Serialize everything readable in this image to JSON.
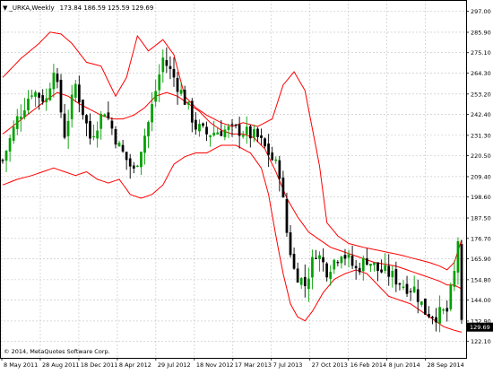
{
  "window": {
    "symbol": "_URKA,Weekly",
    "ohlc": "173.84 186.59 125.59 129.69",
    "copyright": "© 2014, MetaQuotes Software Corp."
  },
  "colors": {
    "background": "#ffffff",
    "grid": "#c0c0c0",
    "band": "#ff0000",
    "bull": "#00a000",
    "bear": "#000000",
    "last_price_label_bg": "#000000",
    "last_price_label_fg": "#ffffff"
  },
  "chart_data": {
    "type": "candlestick",
    "title": "_URKA,Weekly",
    "ylim": [
      121.0,
      303.0
    ],
    "grid": true,
    "y_ticks": [
      "297.00",
      "285.90",
      "275.10",
      "264.30",
      "253.20",
      "242.40",
      "231.30",
      "220.50",
      "209.40",
      "198.60",
      "187.50",
      "176.70",
      "165.90",
      "154.80",
      "144.00",
      "132.90",
      "122.10"
    ],
    "x_ticks": [
      "8 May 2011",
      "28 Aug 2011",
      "18 Dec 2011",
      "8 Apr 2012",
      "29 Jul 2012",
      "18 Nov 2012",
      "17 Mar 2013",
      "7 Jul 2013",
      "27 Oct 2013",
      "16 Feb 2014",
      "8 Jun 2014",
      "28 Sep 2014"
    ],
    "last_price": "129.69",
    "series": [
      {
        "name": "Price",
        "kind": "candles",
        "close_anchors": [
          [
            0,
            218
          ],
          [
            4,
            240
          ],
          [
            8,
            255
          ],
          [
            12,
            250
          ],
          [
            14,
            268
          ],
          [
            17,
            232
          ],
          [
            20,
            258
          ],
          [
            24,
            230
          ],
          [
            28,
            245
          ],
          [
            32,
            225
          ],
          [
            36,
            212
          ],
          [
            40,
            238
          ],
          [
            44,
            272
          ],
          [
            47,
            262
          ],
          [
            50,
            250
          ],
          [
            53,
            236
          ],
          [
            56,
            232
          ],
          [
            60,
            234
          ],
          [
            65,
            234
          ],
          [
            70,
            230
          ],
          [
            73,
            222
          ],
          [
            76,
            212
          ],
          [
            78,
            180
          ],
          [
            80,
            160
          ],
          [
            83,
            152
          ],
          [
            86,
            170
          ],
          [
            89,
            160
          ],
          [
            93,
            170
          ],
          [
            97,
            160
          ],
          [
            100,
            166
          ],
          [
            103,
            160
          ],
          [
            106,
            158
          ],
          [
            110,
            152
          ],
          [
            113,
            150
          ],
          [
            116,
            138
          ],
          [
            119,
            136
          ],
          [
            122,
            138
          ],
          [
            124,
            158
          ],
          [
            125,
            176
          ],
          [
            126,
            130
          ]
        ]
      },
      {
        "name": "Upper Band",
        "kind": "line",
        "points": [
          [
            0,
            262
          ],
          [
            5,
            272
          ],
          [
            10,
            280
          ],
          [
            13,
            286
          ],
          [
            16,
            285
          ],
          [
            19,
            280
          ],
          [
            23,
            270
          ],
          [
            27,
            268
          ],
          [
            31,
            252
          ],
          [
            34,
            262
          ],
          [
            37,
            284
          ],
          [
            40,
            276
          ],
          [
            44,
            282
          ],
          [
            47,
            274
          ],
          [
            50,
            252
          ],
          [
            53,
            246
          ],
          [
            56,
            242
          ],
          [
            60,
            238
          ],
          [
            63,
            236
          ],
          [
            66,
            238
          ],
          [
            70,
            236
          ],
          [
            74,
            240
          ],
          [
            77,
            258
          ],
          [
            80,
            265
          ],
          [
            83,
            255
          ],
          [
            87,
            215
          ],
          [
            89,
            185
          ],
          [
            92,
            178
          ],
          [
            95,
            174
          ],
          [
            99,
            172
          ],
          [
            104,
            170
          ],
          [
            109,
            168
          ],
          [
            113,
            166
          ],
          [
            117,
            164
          ],
          [
            120,
            162
          ],
          [
            122,
            160
          ],
          [
            124,
            164
          ],
          [
            126,
            176
          ]
        ]
      },
      {
        "name": "Middle Band",
        "kind": "line",
        "points": [
          [
            0,
            232
          ],
          [
            4,
            238
          ],
          [
            8,
            244
          ],
          [
            12,
            250
          ],
          [
            15,
            254
          ],
          [
            18,
            252
          ],
          [
            21,
            248
          ],
          [
            24,
            245
          ],
          [
            27,
            242
          ],
          [
            30,
            240
          ],
          [
            33,
            240
          ],
          [
            36,
            242
          ],
          [
            39,
            246
          ],
          [
            42,
            252
          ],
          [
            45,
            254
          ],
          [
            48,
            252
          ],
          [
            51,
            248
          ],
          [
            54,
            244
          ],
          [
            57,
            238
          ],
          [
            60,
            234
          ],
          [
            63,
            232
          ],
          [
            66,
            232
          ],
          [
            69,
            230
          ],
          [
            72,
            224
          ],
          [
            75,
            212
          ],
          [
            78,
            198
          ],
          [
            81,
            188
          ],
          [
            84,
            180
          ],
          [
            87,
            176
          ],
          [
            90,
            172
          ],
          [
            93,
            170
          ],
          [
            96,
            168
          ],
          [
            99,
            166
          ],
          [
            102,
            164
          ],
          [
            105,
            163
          ],
          [
            108,
            162
          ],
          [
            111,
            160
          ],
          [
            114,
            158
          ],
          [
            117,
            156
          ],
          [
            120,
            154
          ],
          [
            122,
            152
          ],
          [
            124,
            152
          ],
          [
            126,
            150
          ]
        ]
      },
      {
        "name": "Lower Band",
        "kind": "line",
        "points": [
          [
            0,
            205
          ],
          [
            4,
            208
          ],
          [
            8,
            210
          ],
          [
            11,
            212
          ],
          [
            14,
            214
          ],
          [
            17,
            212
          ],
          [
            20,
            210
          ],
          [
            23,
            212
          ],
          [
            26,
            208
          ],
          [
            29,
            206
          ],
          [
            32,
            208
          ],
          [
            35,
            200
          ],
          [
            38,
            198
          ],
          [
            41,
            200
          ],
          [
            44,
            205
          ],
          [
            47,
            216
          ],
          [
            50,
            220
          ],
          [
            53,
            222
          ],
          [
            56,
            222
          ],
          [
            60,
            226
          ],
          [
            64,
            226
          ],
          [
            68,
            222
          ],
          [
            71,
            214
          ],
          [
            73,
            200
          ],
          [
            75,
            178
          ],
          [
            77,
            158
          ],
          [
            79,
            142
          ],
          [
            81,
            135
          ],
          [
            83,
            133
          ],
          [
            85,
            138
          ],
          [
            88,
            148
          ],
          [
            91,
            155
          ],
          [
            94,
            158
          ],
          [
            97,
            160
          ],
          [
            100,
            158
          ],
          [
            103,
            152
          ],
          [
            106,
            146
          ],
          [
            109,
            144
          ],
          [
            112,
            142
          ],
          [
            115,
            138
          ],
          [
            118,
            134
          ],
          [
            121,
            130
          ],
          [
            124,
            128
          ],
          [
            126,
            127
          ]
        ]
      }
    ]
  }
}
